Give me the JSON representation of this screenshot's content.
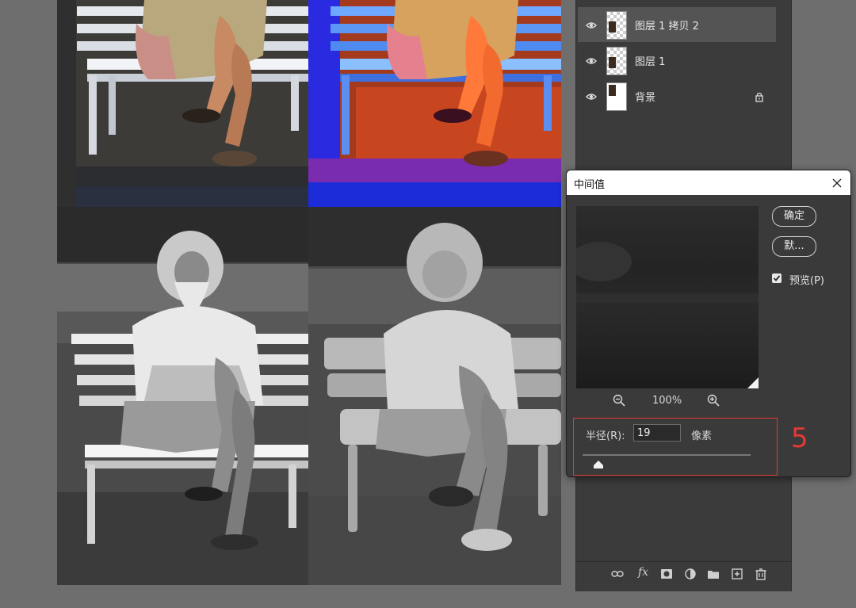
{
  "layers_panel": {
    "layers": [
      {
        "name": "图层 1 拷贝 2",
        "visible": true,
        "selected": true,
        "thumb": "checker",
        "locked": false
      },
      {
        "name": "图层 1",
        "visible": true,
        "selected": false,
        "thumb": "checker",
        "locked": false
      },
      {
        "name": "背景",
        "visible": true,
        "selected": false,
        "thumb": "white",
        "locked": true
      }
    ],
    "footer": {
      "fx_label": "fx"
    }
  },
  "dialog": {
    "title": "中间值",
    "ok_label": "确定",
    "default_label": "默...",
    "preview_label": "预览(P)",
    "preview_checked": true,
    "zoom_level": "100%",
    "radius_label": "半径(R):",
    "radius_value": "19",
    "unit_label": "像素"
  },
  "annotation": {
    "number": "5",
    "color": "#e53935"
  },
  "canvas": {
    "quadrants": [
      "original",
      "color-effect",
      "grayscale",
      "median-blur"
    ]
  }
}
